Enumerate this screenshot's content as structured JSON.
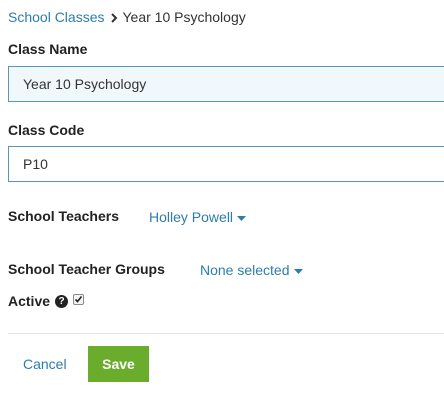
{
  "breadcrumb": {
    "parent": "School Classes",
    "current": "Year 10 Psychology"
  },
  "class_name": {
    "label": "Class Name",
    "value": "Year 10 Psychology"
  },
  "class_code": {
    "label": "Class Code",
    "value": "P10"
  },
  "school_teachers": {
    "label": "School Teachers",
    "selected": "Holley Powell"
  },
  "school_teacher_groups": {
    "label": "School Teacher Groups",
    "selected": "None selected"
  },
  "active": {
    "label": "Active",
    "checked": true
  },
  "actions": {
    "cancel_label": "Cancel",
    "save_label": "Save"
  },
  "colors": {
    "link": "#2d7dab",
    "save_button": "#6aac2b",
    "input_border": "#5d93b5"
  },
  "icons": [
    "chevron-right-icon",
    "caret-down-icon",
    "help-icon",
    "checkmark-icon"
  ]
}
